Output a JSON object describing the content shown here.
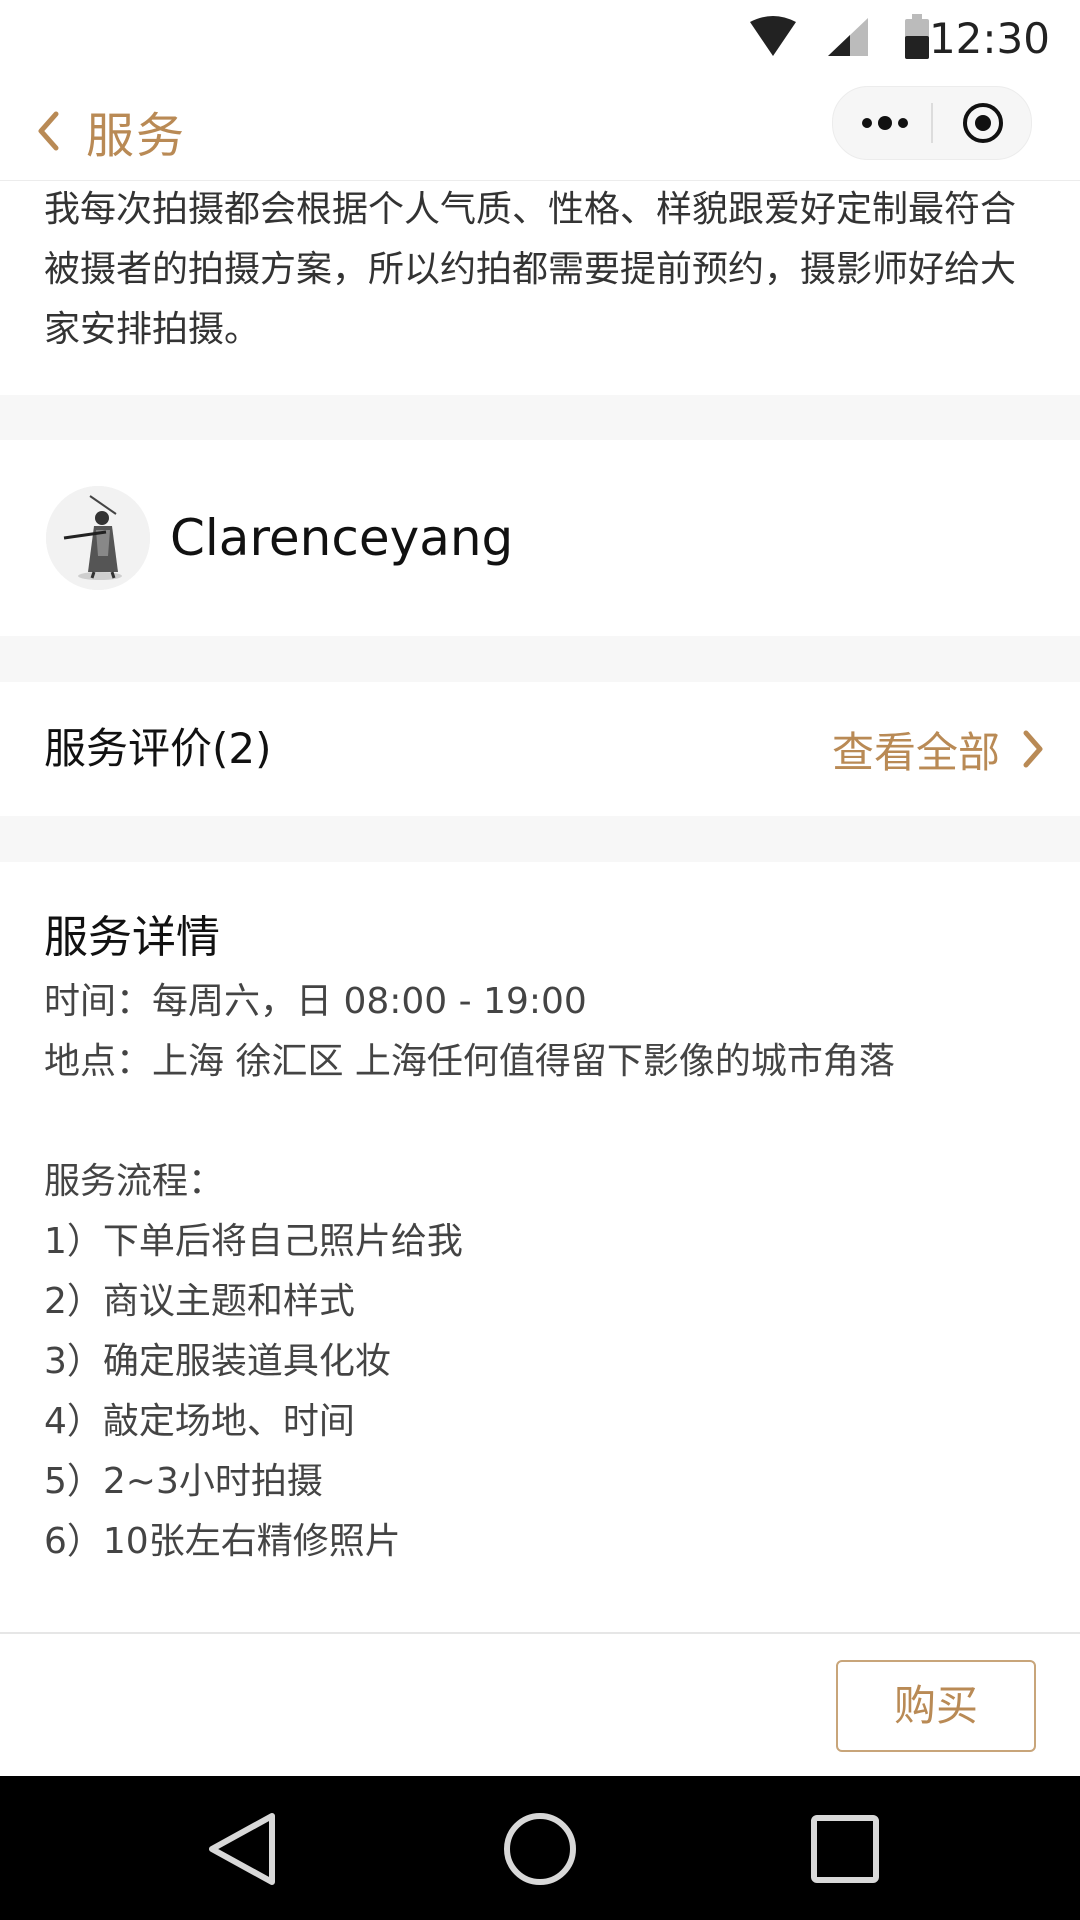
{
  "status_bar": {
    "time": "12:30",
    "icons": [
      "wifi-icon",
      "signal-icon",
      "battery-icon"
    ]
  },
  "nav_bar": {
    "title": "服务",
    "back_icon": "chevron-left-icon",
    "menu_icon": "more-dots-icon",
    "close_icon": "target-icon"
  },
  "intro": {
    "text": "我每次拍摄都会根据个人气质、性格、样貌跟爱好定制最符合被摄者的拍摄方案，所以约拍都需要提前预约，摄影师好给大家安排拍摄。"
  },
  "profile": {
    "name": "Clarenceyang"
  },
  "reviews": {
    "title": "服务评价(2)",
    "view_all": "查看全部"
  },
  "details": {
    "title": "服务详情",
    "time": "时间：每周六，日 08:00 - 19:00",
    "location": "地点：上海 徐汇区 上海任何值得留下影像的城市角落",
    "process_title": "服务流程：",
    "steps": [
      "1）下单后将自己照片给我",
      "2）商议主题和样式",
      "3）确定服装道具化妆",
      "4）敲定场地、时间",
      "5）2~3小时拍摄",
      "6）10张左右精修照片"
    ]
  },
  "bottom_bar": {
    "buy_label": "购买"
  },
  "colors": {
    "accent": "#b98a55",
    "divider": "#f7f7f7"
  }
}
